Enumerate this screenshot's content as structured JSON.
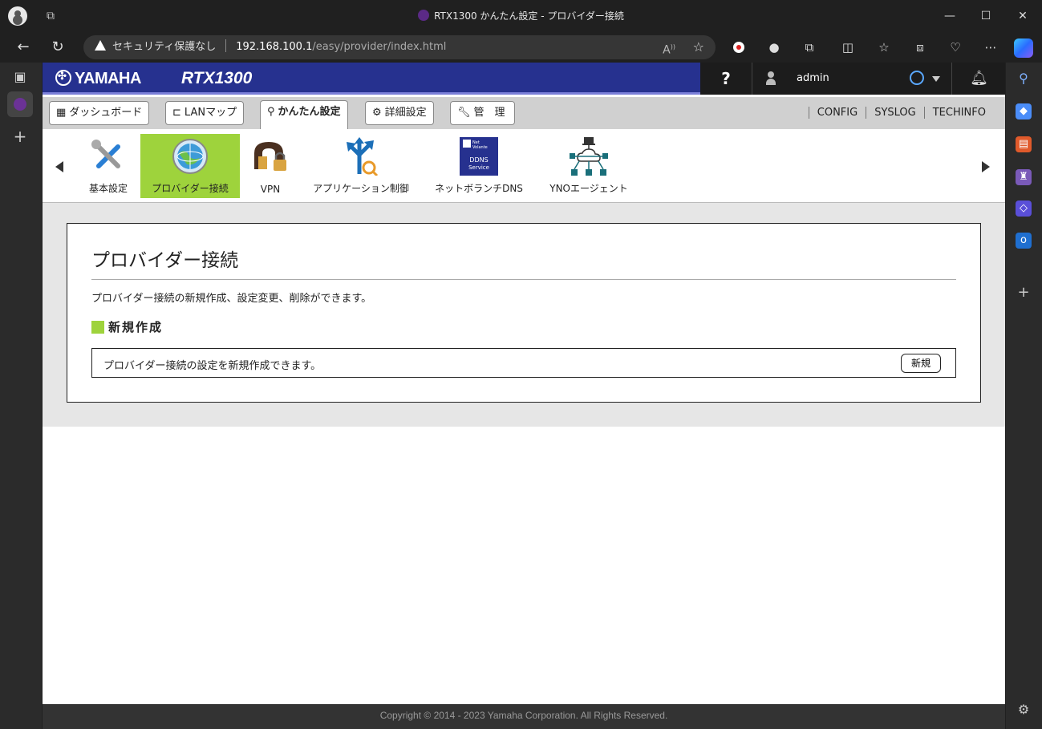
{
  "browser": {
    "window_title": "RTX1300 かんたん設定 - プロバイダー接続",
    "security_label": "セキュリティ保護なし",
    "url_host": "192.168.100.1",
    "url_path": "/easy/provider/index.html"
  },
  "header": {
    "brand": "YAMAHA",
    "model": "RTX1300",
    "help": "?",
    "username": "admin"
  },
  "menu": {
    "tabs": [
      {
        "label": "ダッシュボード"
      },
      {
        "label": "LANマップ"
      },
      {
        "label": "かんたん設定"
      },
      {
        "label": "詳細設定"
      },
      {
        "label": "管　理"
      }
    ],
    "links": [
      "CONFIG",
      "SYSLOG",
      "TECHINFO"
    ]
  },
  "iconbar": {
    "items": [
      {
        "label": "基本設定"
      },
      {
        "label": "プロバイダー接続"
      },
      {
        "label": "VPN"
      },
      {
        "label": "アプリケーション制御"
      },
      {
        "label": "ネットボランチDNS"
      },
      {
        "label": "YNOエージェント"
      }
    ],
    "ddns_art_text": [
      "Net",
      "Volante",
      "DDNS",
      "Service"
    ]
  },
  "panel": {
    "title": "プロバイダー接続",
    "description": "プロバイダー接続の新規作成、設定変更、削除ができます。",
    "section_title": "新規作成",
    "new_box_text": "プロバイダー接続の設定を新規作成できます。",
    "new_button": "新規"
  },
  "footer": {
    "copyright": "Copyright © 2014 - 2023 Yamaha Corporation. All Rights Reserved."
  },
  "colors": {
    "header_blue": "#26318f",
    "active_green": "#9ed33c"
  }
}
